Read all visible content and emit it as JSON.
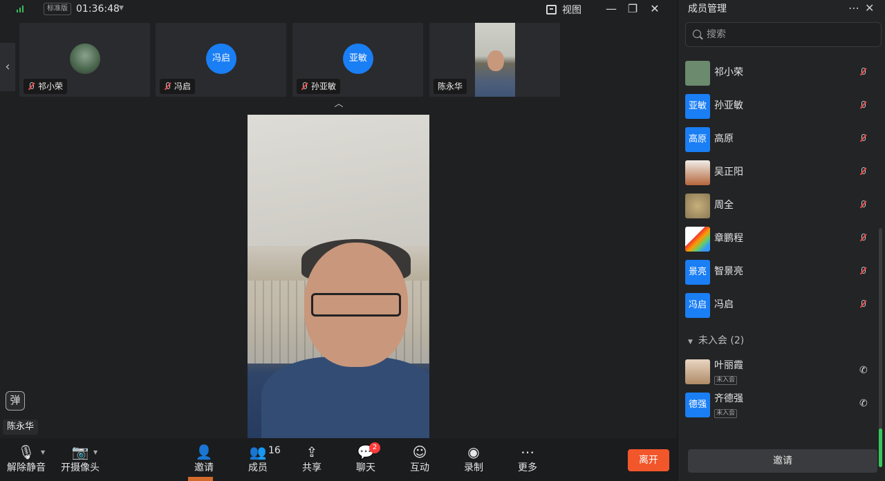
{
  "topbar": {
    "edition": "标准版",
    "timer": "01:36:48",
    "view_label": "视图"
  },
  "thumbnails": [
    {
      "name": "祁小荣",
      "type": "photo",
      "muted": true
    },
    {
      "name": "冯启",
      "type": "initials",
      "initials": "冯启",
      "muted": true
    },
    {
      "name": "孙亚敏",
      "type": "initials",
      "initials": "亚敏",
      "muted": true
    },
    {
      "name": "陈永华",
      "type": "video",
      "muted": false
    }
  ],
  "main_video": {
    "speaker": "陈永华",
    "danmaku_icon": "弹"
  },
  "toolbar": {
    "unmute_label": "解除静音",
    "camera_label": "开摄像头",
    "invite_label": "邀请",
    "members_label": "成员",
    "members_count": "16",
    "share_label": "共享",
    "chat_label": "聊天",
    "chat_badge": "2",
    "interact_label": "互动",
    "record_label": "录制",
    "more_label": "更多",
    "leave_label": "离开"
  },
  "panel": {
    "title": "成员管理",
    "search_placeholder": "搜索",
    "members": [
      {
        "name": "祁小荣",
        "avatar": "",
        "kind": "photo",
        "color": "#6b8a6e"
      },
      {
        "name": "孙亚敏",
        "avatar": "亚敏",
        "kind": "initials",
        "color": "#1a7ef5"
      },
      {
        "name": "高原",
        "avatar": "高原",
        "kind": "initials",
        "color": "#1a7ef5"
      },
      {
        "name": "吴正阳",
        "avatar": "",
        "kind": "photo",
        "color": "#b5663c"
      },
      {
        "name": "周全",
        "avatar": "",
        "kind": "photo",
        "color": "#b39a6a"
      },
      {
        "name": "章鹏程",
        "avatar": "",
        "kind": "photo",
        "color": "#e8e0da"
      },
      {
        "name": "智景亮",
        "avatar": "景亮",
        "kind": "initials",
        "color": "#1a7ef5"
      },
      {
        "name": "冯启",
        "avatar": "冯启",
        "kind": "initials",
        "color": "#1a7ef5"
      }
    ],
    "not_joined_label": "未入会 (2)",
    "not_joined": [
      {
        "name": "叶丽霞",
        "avatar": "",
        "kind": "photo",
        "color": "#cfa27a",
        "tag": "未入会"
      },
      {
        "name": "齐德强",
        "avatar": "德强",
        "kind": "initials",
        "color": "#1a7ef5",
        "tag": "未入会"
      }
    ],
    "invite_label": "邀请"
  },
  "colors": {
    "accent_blue": "#1a7ef5",
    "leave_orange": "#f2562b",
    "badge_red": "#ff3b3b",
    "signal_green": "#39c15a"
  }
}
